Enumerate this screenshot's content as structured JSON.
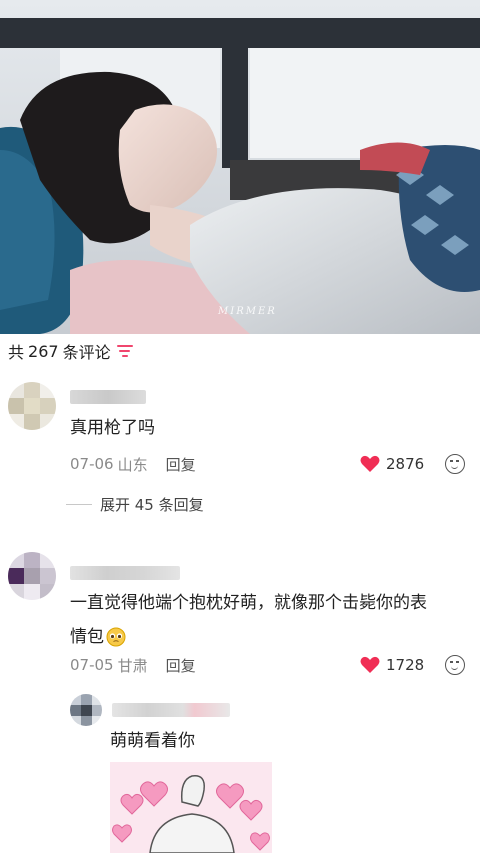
{
  "video": {
    "watermark": "MIRMER"
  },
  "comments_header": {
    "prefix": "共",
    "count": "267",
    "suffix": "条评论"
  },
  "comments": [
    {
      "text": "真用枪了吗",
      "date": "07-06",
      "location": "山东",
      "reply_label": "回复",
      "likes": "2876",
      "expand_label": "展开 45 条回复"
    },
    {
      "text_line1": "一直觉得他端个抱枕好萌，就像那个击毙你的表",
      "text_line2": "情包",
      "date": "07-05",
      "location": "甘肃",
      "reply_label": "回复",
      "likes": "1728"
    }
  ],
  "reply": {
    "text": "萌萌看着你"
  },
  "icons": {
    "like": "heart-icon",
    "emoji": "smiley-face-icon",
    "sort": "sort-filter-icon",
    "inline_emoji": "pleading-face-emoji"
  },
  "colors": {
    "accent_pink": "#f0466e",
    "heart_red": "#f02e55",
    "meta_gray": "#8a8a8a"
  }
}
